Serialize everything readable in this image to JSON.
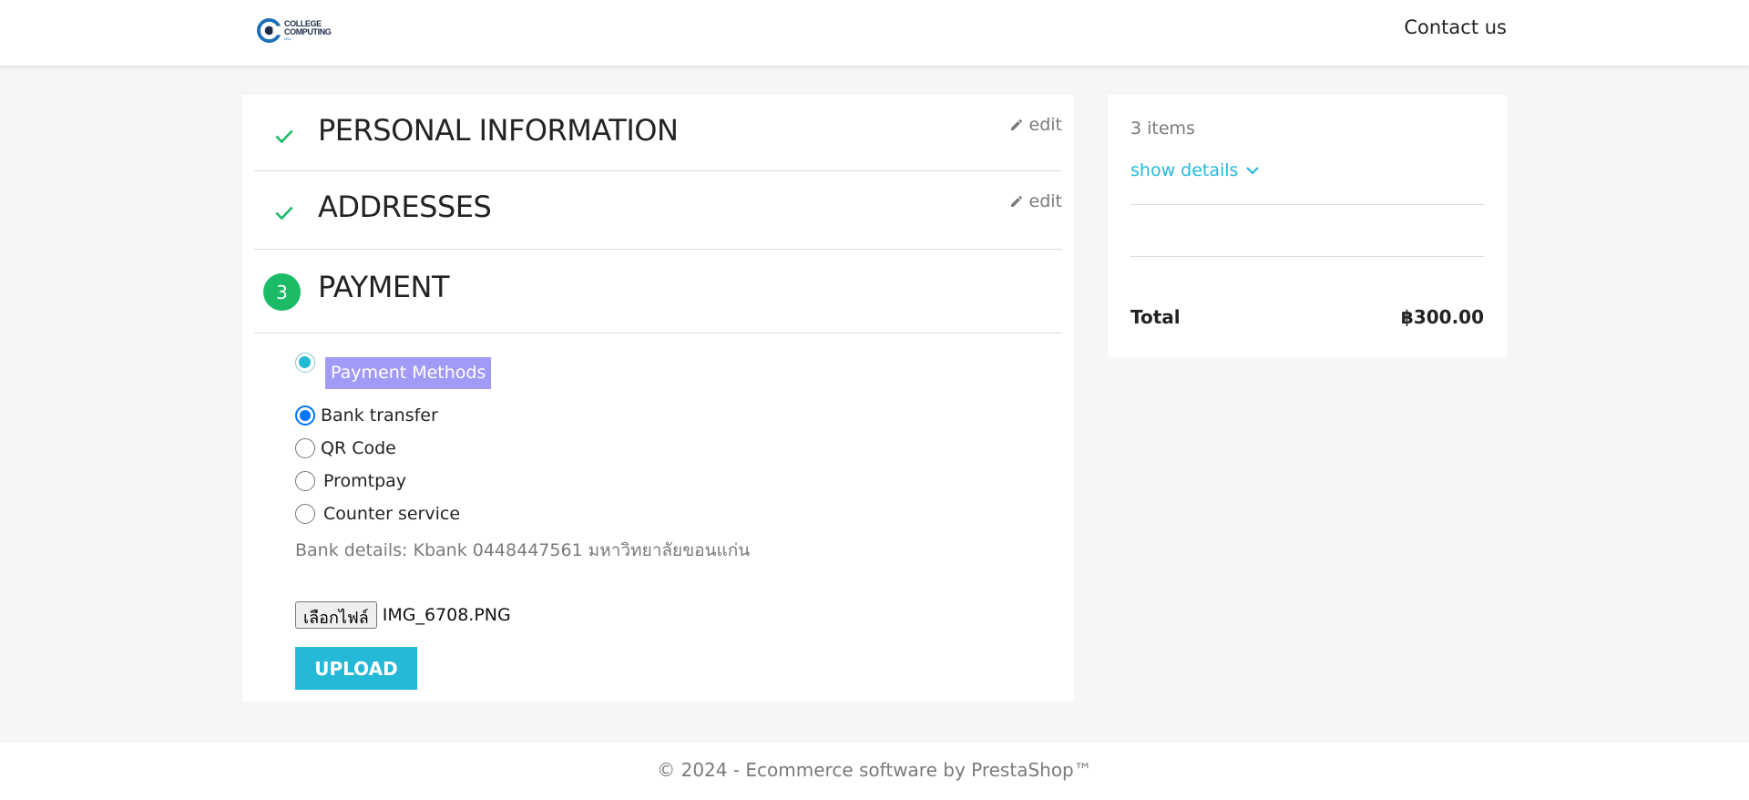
{
  "header": {
    "logo_line1": "COLLEGE",
    "logo_line2": "COMPUTING",
    "logo_badge": "KKU",
    "contact_label": "Contact us"
  },
  "steps": [
    {
      "title": "PERSONAL INFORMATION",
      "status": "complete",
      "edit_label": "edit"
    },
    {
      "title": "ADDRESSES",
      "status": "complete",
      "edit_label": "edit"
    },
    {
      "title": "PAYMENT",
      "status": "current",
      "number": "3"
    }
  ],
  "payment": {
    "methods_label": "Payment Methods",
    "options": [
      {
        "label": "Bank transfer",
        "selected": true
      },
      {
        "label": "QR Code",
        "selected": false
      },
      {
        "label": "Promtpay",
        "selected": false
      },
      {
        "label": "Counter service",
        "selected": false
      }
    ],
    "bank_details": "Bank details: Kbank 0448447561 มหาวิทยาลัยขอนแก่น",
    "file_button_label": "เลือกไฟล์",
    "file_name": "IMG_6708.PNG",
    "upload_label": "UPLOAD"
  },
  "summary": {
    "items_count": "3 items",
    "show_details_label": "show details",
    "total_label": "Total",
    "total_value": "฿300.00"
  },
  "footer": {
    "copyright": "© 2024 - Ecommerce software by PrestaShop™"
  },
  "colors": {
    "accent": "#24b9d7",
    "success": "#1cbc67",
    "highlight": "#a19bf6",
    "radio_selected": "#0075ff"
  }
}
